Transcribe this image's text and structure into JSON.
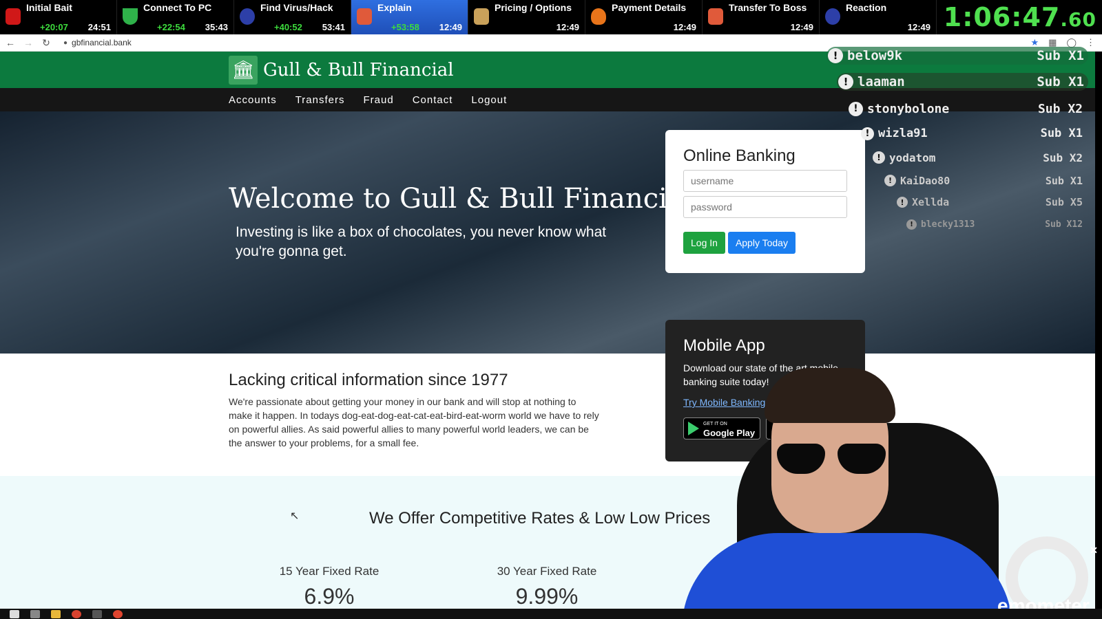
{
  "splits": [
    {
      "name": "Initial Bait",
      "delta": "+20:07",
      "time": "24:51",
      "icon_color": "#d01818",
      "active": false
    },
    {
      "name": "Connect To PC",
      "delta": "+22:54",
      "time": "35:43",
      "icon_color": "#2fb24a",
      "active": false
    },
    {
      "name": "Find Virus/Hack",
      "delta": "+40:52",
      "time": "53:41",
      "icon_color": "#2d3fa8",
      "active": false
    },
    {
      "name": "Explain",
      "delta": "+53:58",
      "time": "12:49",
      "icon_color": "#e05a3a",
      "active": true
    },
    {
      "name": "Pricing / Options",
      "delta": "",
      "time": "12:49",
      "icon_color": "#c9a15a",
      "active": false
    },
    {
      "name": "Payment Details",
      "delta": "",
      "time": "12:49",
      "icon_color": "#e8741a",
      "active": false
    },
    {
      "name": "Transfer To Boss",
      "delta": "",
      "time": "12:49",
      "icon_color": "#e05a3a",
      "active": false
    },
    {
      "name": "Reaction",
      "delta": "",
      "time": "12:49",
      "icon_color": "#2d3fa8",
      "active": false
    }
  ],
  "timer": {
    "main": "1:06:47",
    "fraction": ".60"
  },
  "browser": {
    "url": "gbfinancial.bank"
  },
  "site": {
    "brand": "Gull & Bull Financial",
    "nav": [
      "Accounts",
      "Transfers",
      "Fraud",
      "Contact",
      "Logout"
    ],
    "hero": {
      "title": "Welcome to Gull & Bull Financial",
      "subtitle": "Investing is like a box of chocolates, you never know what you're gonna get."
    },
    "login": {
      "title": "Online Banking",
      "username_placeholder": "username",
      "password_placeholder": "password",
      "login_label": "Log In",
      "apply_label": "Apply Today"
    },
    "mobile": {
      "title": "Mobile App",
      "text": "Download our state of the art mobile banking suite today!",
      "link": "Try Mobile Banking",
      "gplay_small": "GET IT ON",
      "gplay_big": "Google Play"
    },
    "info": {
      "title": "Lacking critical information since 1977",
      "text": "We're passionate about getting your money in our bank and will stop at nothing to make it happen. In todays dog-eat-dog-eat-cat-eat-bird-eat-worm world we have to rely on powerful allies. As said powerful allies to many powerful world leaders, we can be the answer to your problems, for a small fee."
    },
    "rates": {
      "title": "We Offer Competitive Rates & Low Low Prices",
      "items": [
        {
          "label": "15 Year Fixed Rate",
          "value": "6.9%"
        },
        {
          "label": "30 Year Fixed Rate",
          "value": "9.99%"
        }
      ]
    }
  },
  "alerts": [
    {
      "user": "below9k",
      "sub": "Sub X1"
    },
    {
      "user": "laaman",
      "sub": "Sub X1"
    },
    {
      "user": "stonybolone",
      "sub": "Sub X2"
    },
    {
      "user": "wizla91",
      "sub": "Sub X1"
    },
    {
      "user": "yodatom",
      "sub": "Sub X2"
    },
    {
      "user": "KaiDao80",
      "sub": "Sub X1"
    },
    {
      "user": "Xellda",
      "sub": "Sub X5"
    },
    {
      "user": "blecky1313",
      "sub": "Sub X12"
    }
  ],
  "overlay": {
    "emometer": "emometer"
  },
  "colors": {
    "site_green": "#0c7a3e",
    "timer_green": "#4fe04f",
    "active_split": "#2f6fe0"
  }
}
